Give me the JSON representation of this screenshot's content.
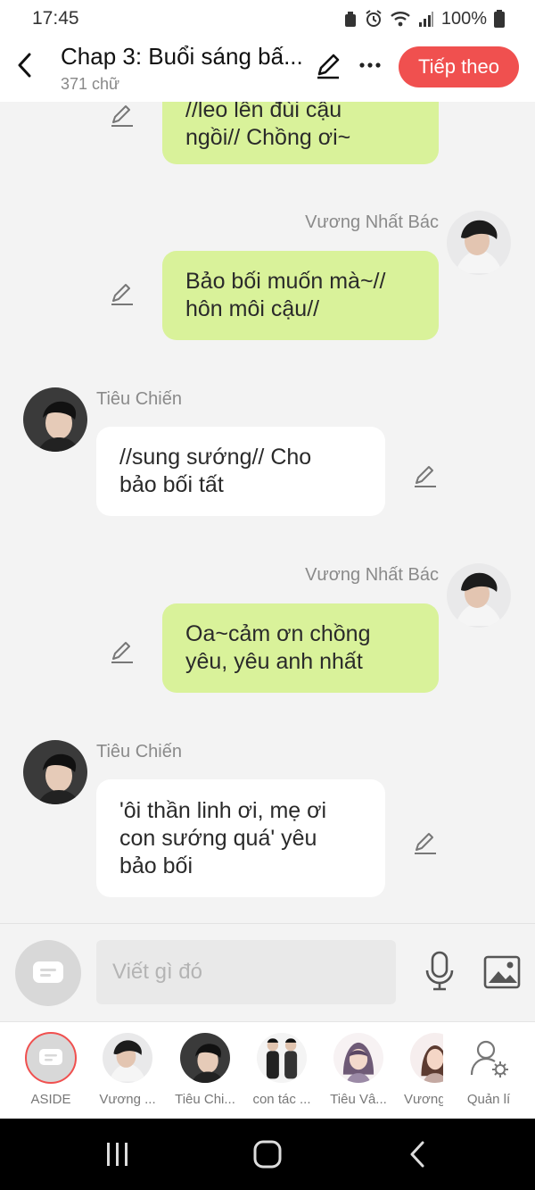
{
  "status_bar": {
    "time": "17:45",
    "battery": "100%"
  },
  "header": {
    "title": "Chap 3: Buổi sáng bấ...",
    "word_count": "371 chữ",
    "next_label": "Tiếp theo"
  },
  "messages": [
    {
      "side": "right",
      "lines": [
        "//leo lên đùi cậu",
        "ngồi// Chồng ơi~"
      ]
    },
    {
      "side": "right",
      "sender": "Vương Nhất Bác",
      "lines": [
        "Bảo bối muốn mà~//",
        "hôn môi cậu//"
      ]
    },
    {
      "side": "left",
      "sender": "Tiêu Chiến",
      "lines": [
        "//sung sướng// Cho",
        "bảo bối tất"
      ]
    },
    {
      "side": "right",
      "sender": "Vương Nhất Bác",
      "lines": [
        "Oa~cảm ơn chồng",
        "yêu, yêu anh nhất"
      ]
    },
    {
      "side": "left",
      "sender": "Tiêu Chiến",
      "lines": [
        "'ôi thần linh ơi, mẹ ơi",
        "con sướng quá' yêu",
        "bảo bối"
      ]
    }
  ],
  "composer": {
    "placeholder": "Viết gì đó"
  },
  "characters": [
    {
      "label": "ASIDE"
    },
    {
      "label": "Vương ..."
    },
    {
      "label": "Tiêu Chi..."
    },
    {
      "label": "con tác ..."
    },
    {
      "label": "Tiêu Vâ..."
    },
    {
      "label": "Vương"
    },
    {
      "label": "Quản lí"
    }
  ],
  "colors": {
    "accent": "#f0504f",
    "bubble_right": "#d9f29a",
    "bubble_left": "#ffffff",
    "background": "#f3f3f3"
  }
}
